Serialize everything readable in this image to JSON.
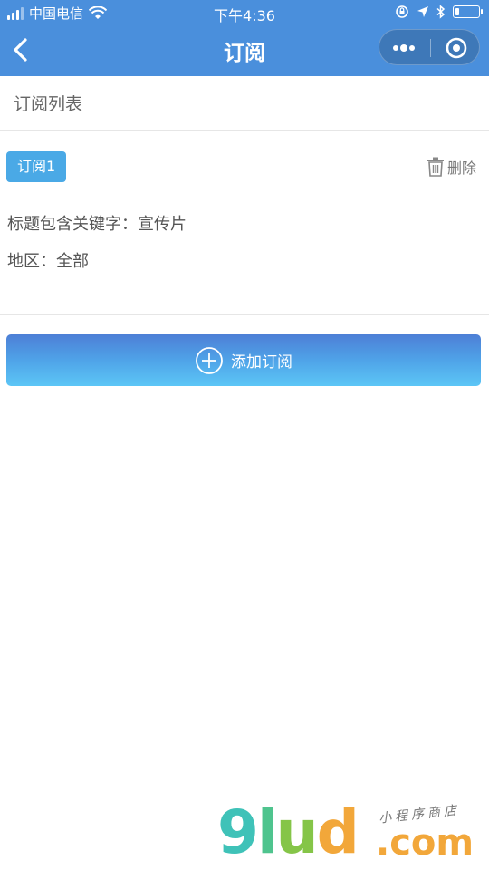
{
  "statusbar": {
    "carrier": "中国电信",
    "time": "下午4:36",
    "battery_level": 0.15
  },
  "navbar": {
    "title": "订阅",
    "back_icon": "chevron-left-icon",
    "more_icon": "more-dots-icon",
    "close_icon": "target-circle-icon"
  },
  "list": {
    "header": "订阅列表"
  },
  "subscriptions": [
    {
      "tag": "订阅1",
      "delete_label": "删除",
      "keyword_line": "标题包含关键字：宣传片",
      "region_line": "地区：全部"
    }
  ],
  "actions": {
    "add_label": "添加订阅",
    "add_icon": "plus-circle-icon"
  },
  "watermark": {
    "brand": "9lud",
    "domain": ".com",
    "tagline": "小程序商店"
  },
  "colors": {
    "primary": "#4a8fdc",
    "tag": "#4aa9e6",
    "divider": "#e6e6e6"
  }
}
